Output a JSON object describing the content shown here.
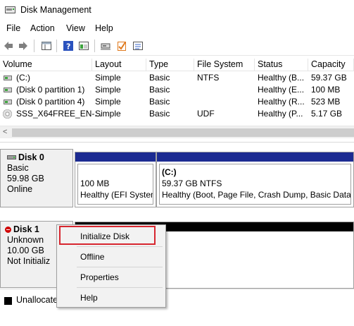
{
  "window": {
    "title": "Disk Management",
    "icon": "disk-management-icon"
  },
  "menubar": {
    "items": [
      "File",
      "Action",
      "View",
      "Help"
    ]
  },
  "toolbar": {
    "buttons": [
      "back-arrow-icon",
      "forward-arrow-icon",
      "console-tree-icon",
      "help-icon",
      "show-hide-icon",
      "connect-icon",
      "check-icon",
      "properties-icon"
    ]
  },
  "volume_list": {
    "columns": [
      "Volume",
      "Layout",
      "Type",
      "File System",
      "Status",
      "Capacity"
    ],
    "rows": [
      {
        "volume": "(C:)",
        "layout": "Simple",
        "type": "Basic",
        "fs": "NTFS",
        "status": "Healthy (B...",
        "capacity": "59.37 GB",
        "icon": "volume-icon"
      },
      {
        "volume": "(Disk 0 partition 1)",
        "layout": "Simple",
        "type": "Basic",
        "fs": "",
        "status": "Healthy (E...",
        "capacity": "100 MB",
        "icon": "volume-icon"
      },
      {
        "volume": "(Disk 0 partition 4)",
        "layout": "Simple",
        "type": "Basic",
        "fs": "",
        "status": "Healthy (R...",
        "capacity": "523 MB",
        "icon": "volume-icon"
      },
      {
        "volume": "SSS_X64FREE_EN-...",
        "layout": "Simple",
        "type": "Basic",
        "fs": "UDF",
        "status": "Healthy (P...",
        "capacity": "5.17 GB",
        "icon": "cd-icon"
      }
    ],
    "scroll_left": "<"
  },
  "disks": [
    {
      "title": "Disk 0",
      "type": "Basic",
      "size": "59.98 GB",
      "state": "Online",
      "partitions": [
        {
          "name": "",
          "size": "100 MB",
          "status": "Healthy (EFI System"
        },
        {
          "name": "(C:)",
          "size": "59.37 GB NTFS",
          "status": "Healthy (Boot, Page File, Crash Dump, Basic Data I"
        }
      ]
    },
    {
      "title": "Disk 1",
      "type": "Unknown",
      "size": "10.00 GB",
      "state": "Not Initializ"
    }
  ],
  "context_menu": {
    "items": [
      "Initialize Disk",
      "Offline",
      "Properties",
      "Help"
    ],
    "highlighted": "Initialize Disk"
  },
  "legend": {
    "unallocated": "Unallocate",
    "unallocated_color": "#000000",
    "primary_color": "#1c2b91"
  }
}
